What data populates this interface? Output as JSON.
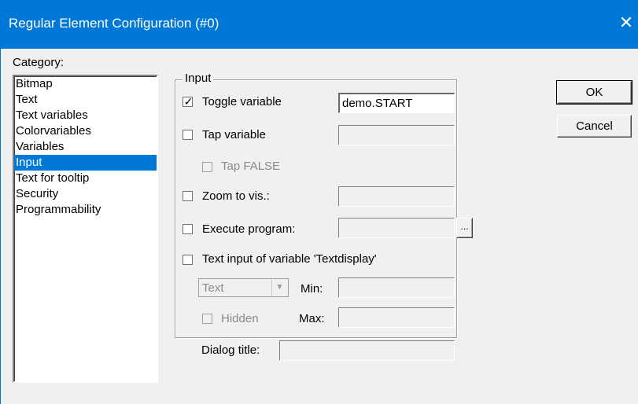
{
  "window": {
    "title": "Regular Element Configuration (#0)",
    "close_glyph": "✕"
  },
  "category": {
    "label": "Category:",
    "items": [
      "Bitmap",
      "Text",
      "Text variables",
      "Colorvariables",
      "Variables",
      "Input",
      "Text for tooltip",
      "Security",
      "Programmability"
    ],
    "selected": "Input"
  },
  "input_group": {
    "title": "Input",
    "toggle_variable": {
      "label": "Toggle variable",
      "checked": true,
      "value": "demo.START"
    },
    "tap_variable": {
      "label": "Tap variable",
      "checked": false,
      "value": ""
    },
    "tap_false": {
      "label": "Tap FALSE",
      "checked": false
    },
    "zoom_to_vis": {
      "label": "Zoom to vis.:",
      "checked": false,
      "value": ""
    },
    "execute_program": {
      "label": "Execute program:",
      "checked": false,
      "value": "",
      "browse_label": "..."
    },
    "text_input": {
      "label": "Text input of variable 'Textdisplay'",
      "checked": false
    },
    "type_select": {
      "value": "Text"
    },
    "min": {
      "label": "Min:",
      "value": ""
    },
    "max": {
      "label": "Max:",
      "value": ""
    },
    "hidden": {
      "label": "Hidden",
      "checked": false
    }
  },
  "dialog_title": {
    "label": "Dialog title:",
    "value": ""
  },
  "buttons": {
    "ok": "OK",
    "cancel": "Cancel"
  },
  "check_glyph": "✓"
}
